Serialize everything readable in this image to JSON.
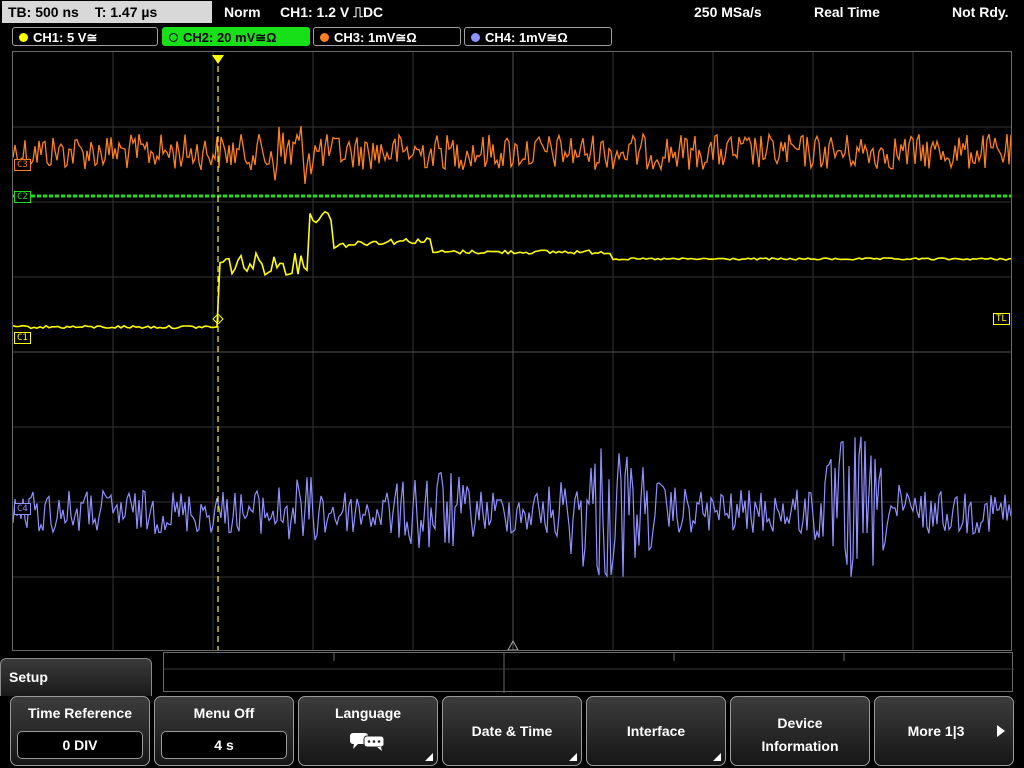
{
  "header": {
    "timebase": "TB: 500 ns",
    "trigger_time": "T: 1.47 µs",
    "mode": "Norm",
    "trigger_setting": "CH1: 1.2 V ⎍DC",
    "sample_rate": "250 MSa/s",
    "acquisition": "Real Time",
    "status": "Not Rdy."
  },
  "channels": [
    {
      "label": "CH1: 5 V≅",
      "color": "#ffff00"
    },
    {
      "label": "CH2: 20 mV≅Ω",
      "color": "#18e018"
    },
    {
      "label": "CH3: 1mV≅Ω",
      "color": "#ff8020"
    },
    {
      "label": "CH4: 1mV≅Ω",
      "color": "#9090ff"
    }
  ],
  "markers": {
    "c1": "C1",
    "c2": "C2",
    "c3": "C3",
    "c4": "C4",
    "trigger_level": "TL",
    "trigger_position": "T"
  },
  "menu": {
    "title": "Setup",
    "softkeys": [
      {
        "label": "Time Reference",
        "value": "0 DIV"
      },
      {
        "label": "Menu Off",
        "value": "4 s"
      },
      {
        "label": "Language",
        "icon": "speech-bubbles-icon"
      },
      {
        "label": "Date & Time"
      },
      {
        "label": "Interface"
      },
      {
        "label_line1": "Device",
        "label_line2": "Information"
      },
      {
        "label": "More 1|3"
      }
    ]
  }
}
